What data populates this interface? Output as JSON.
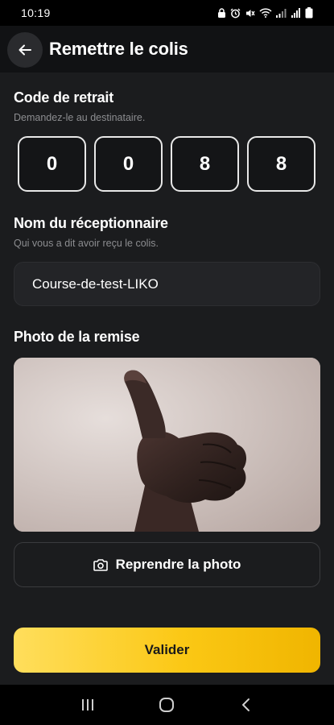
{
  "status_bar": {
    "time": "10:19"
  },
  "header": {
    "title": "Remettre le colis"
  },
  "pickup_code": {
    "title": "Code de retrait",
    "subtitle": "Demandez-le au destinataire.",
    "digits": [
      "0",
      "0",
      "8",
      "8"
    ]
  },
  "receiver": {
    "title": "Nom du réceptionnaire",
    "subtitle": "Qui vous a dit avoir reçu le colis.",
    "value": "Course-de-test-LIKO"
  },
  "photo": {
    "title": "Photo de la remise"
  },
  "actions": {
    "retake_label": "Reprendre la photo",
    "validate_label": "Valider"
  },
  "colors": {
    "accent": "#fbc815",
    "background": "#1b1c1e"
  },
  "icons": {
    "back": "arrow-left-icon",
    "camera": "camera-icon",
    "nav_recents": "recents-icon",
    "nav_home": "home-icon",
    "nav_back": "chevron-left-icon"
  }
}
